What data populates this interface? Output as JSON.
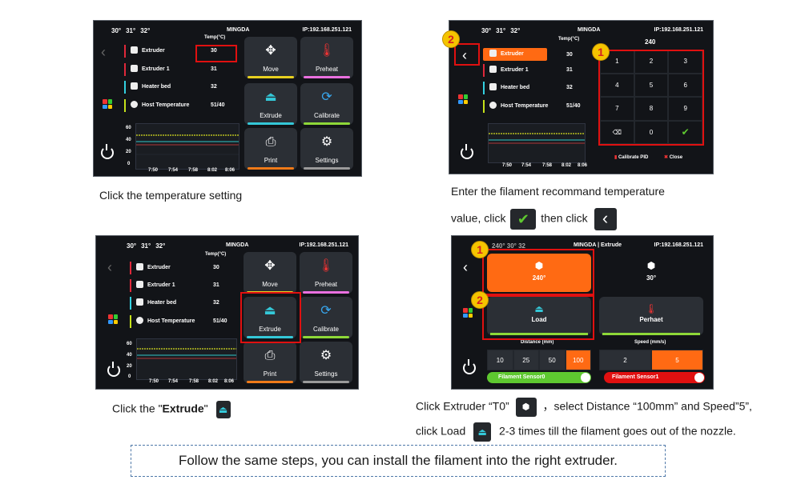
{
  "status": {
    "t1": "30°",
    "t2": "31°",
    "t3": "32°",
    "brand": "MINGDA",
    "brand_extrude": "MINGDA | Extrude",
    "ip": "IP:192.168.251.121"
  },
  "temp_header": "Temp(°C)",
  "temps": [
    {
      "label": "Extruder",
      "value": "30"
    },
    {
      "label": "Extruder 1",
      "value": "31"
    },
    {
      "label": "Heater bed",
      "value": "32"
    },
    {
      "label": "Host Temperature",
      "value": "51/40"
    }
  ],
  "chart": {
    "yticks": [
      "60",
      "40",
      "20",
      "0"
    ],
    "xticks": [
      "7:50",
      "7:54",
      "7:58",
      "8:02",
      "8:06"
    ]
  },
  "tiles": {
    "move": "Move",
    "preheat": "Preheat",
    "extrude": "Extrude",
    "calibrate": "Calibrate",
    "print": "Print",
    "settings": "Settings"
  },
  "keypad": {
    "display": "240",
    "keys": [
      "1",
      "2",
      "3",
      "4",
      "5",
      "6",
      "7",
      "8",
      "9",
      "⌫",
      "0",
      "✔"
    ],
    "calibrate_pid": "Calibrate PID",
    "close": "Close"
  },
  "extrude_panel": {
    "t0_temp": "240°",
    "t1_temp": "30°",
    "load": "Load",
    "preheat": "Perhaet",
    "distance_label": "Distance (mm)",
    "distances": [
      "10",
      "25",
      "50",
      "100"
    ],
    "speed_label": "Speed (mm/s)",
    "speeds": [
      "2",
      "5"
    ],
    "sensor0": "Filament Sensor0",
    "sensor1": "Filament Sensor1",
    "status_line": "240° 30° 32"
  },
  "badges": {
    "one": "1",
    "two": "2"
  },
  "captions": {
    "step1": "Click the temperature setting",
    "step2a": "Enter the filament recommand temperature",
    "step2b_1": "value, click",
    "step2b_2": "then click",
    "step3_1": "Click the \"",
    "step3_bold": "Extrude",
    "step3_2": "\"",
    "step4a_1": "Click Extruder “T0”",
    "step4a_2": "，select Distance “100mm” and Speed”5”,",
    "step4b_1": "click Load",
    "step4b_2": "2-3 times till the filament goes out of the nozzle.",
    "final": "Follow the same steps, you can install the filament into the right extruder."
  },
  "colors": {
    "extruder_bar": "#e0283a",
    "heater_bar": "#33d0e0",
    "host_bar": "#c6e21a",
    "move_line": "#e8d020",
    "preheat_line": "#ea70e0",
    "extrude_line": "#34c8d8",
    "calibrate_line": "#8ed838",
    "print_line": "#f07a18",
    "settings_line": "#9a9a9a",
    "orange": "#ff6a13",
    "green": "#5ec830",
    "red": "#e01010"
  }
}
